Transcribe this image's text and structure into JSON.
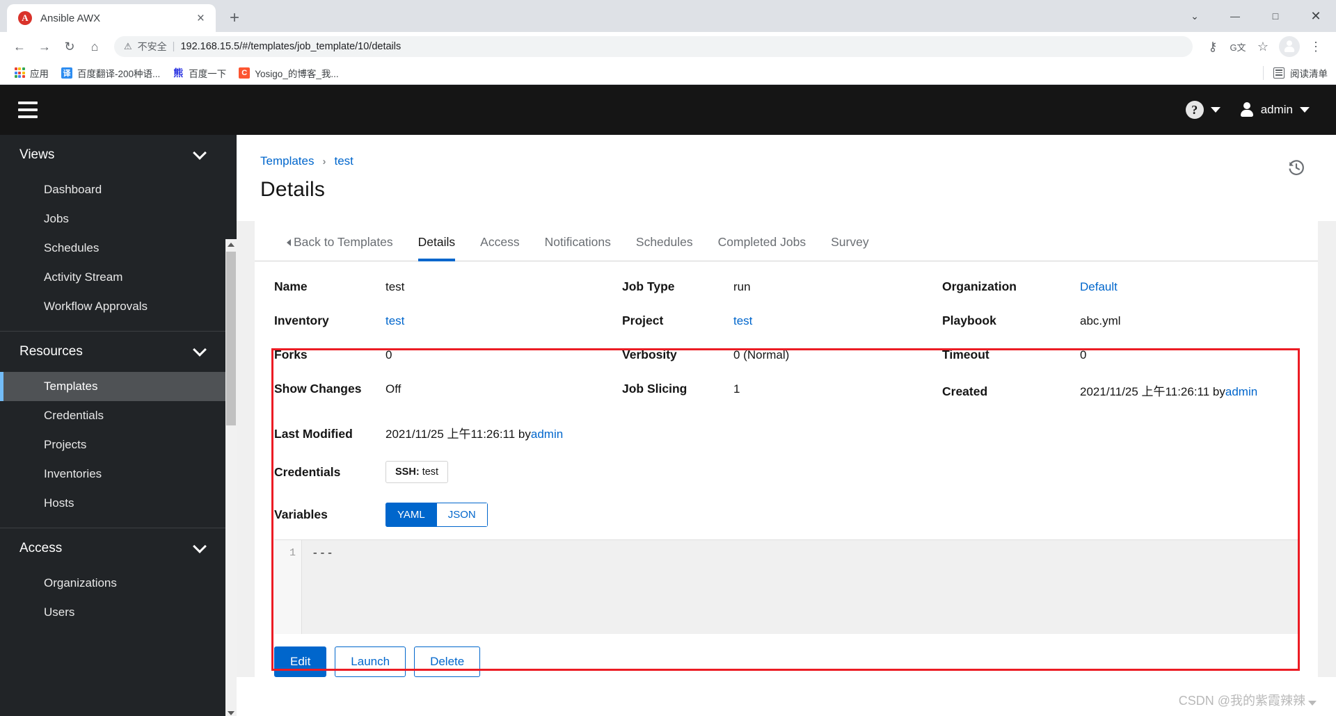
{
  "browser": {
    "tab": {
      "title": "Ansible AWX",
      "favicon_letter": "A",
      "favicon_name": "ansible-logo-icon",
      "close_label": "×"
    },
    "new_tab_label": "+",
    "window_controls": {
      "more": "⌄",
      "minimize": "—",
      "maximize": "□",
      "close": "✕"
    },
    "nav": {
      "back": "←",
      "forward": "→",
      "reload": "↻",
      "home": "⌂"
    },
    "omnibox": {
      "warning_glyph": "⚠",
      "security_text": "不安全",
      "separator": "|",
      "url": "192.168.15.5/#/templates/job_template/10/details"
    },
    "toolbar_right": {
      "password": "⚷",
      "translate": "G文",
      "bookmark_star": "☆",
      "menu": "⋮"
    },
    "bookmarks": [
      {
        "label": "应用",
        "icon": "apps-grid-icon",
        "color": "#4285f4"
      },
      {
        "label": "百度翻译-200种语...",
        "icon": "baidu-translate-icon",
        "glyph": "译",
        "color": "#2d8cf0"
      },
      {
        "label": "百度一下",
        "icon": "baidu-icon",
        "glyph": "熊",
        "color": "#2932e1"
      },
      {
        "label": "Yosigo_的博客_我...",
        "icon": "csdn-icon",
        "glyph": "C",
        "color": "#fc5531"
      }
    ],
    "reading_list": {
      "label": "阅读清单",
      "icon": "reading-list-icon"
    }
  },
  "app_header": {
    "menu_icon": "hamburger-menu-icon",
    "help": {
      "icon": "question-circle-icon",
      "glyph": "?"
    },
    "user": {
      "name": "admin",
      "icon": "user-avatar-icon"
    }
  },
  "sidebar": {
    "sections": [
      {
        "title": "Views",
        "items": [
          "Dashboard",
          "Jobs",
          "Schedules",
          "Activity Stream",
          "Workflow Approvals"
        ]
      },
      {
        "title": "Resources",
        "items": [
          "Templates",
          "Credentials",
          "Projects",
          "Inventories",
          "Hosts"
        ],
        "active": "Templates"
      },
      {
        "title": "Access",
        "items": [
          "Organizations",
          "Users"
        ]
      }
    ]
  },
  "main": {
    "breadcrumb": {
      "root": "Templates",
      "separator": "›",
      "current": "test"
    },
    "page_title": "Details",
    "history_icon": "history-clock-icon",
    "tabs": [
      {
        "label": "Back to Templates",
        "kind": "back"
      },
      {
        "label": "Details",
        "selected": true
      },
      {
        "label": "Access"
      },
      {
        "label": "Notifications"
      },
      {
        "label": "Schedules"
      },
      {
        "label": "Completed Jobs"
      },
      {
        "label": "Survey"
      }
    ],
    "details": {
      "col1": [
        {
          "label": "Name",
          "value": "test",
          "link": false
        },
        {
          "label": "Inventory",
          "value": "test",
          "link": true
        },
        {
          "label": "Forks",
          "value": "0",
          "link": false
        },
        {
          "label": "Show Changes",
          "value": "Off",
          "link": false
        }
      ],
      "col2": [
        {
          "label": "Job Type",
          "value": "run",
          "link": false
        },
        {
          "label": "Project",
          "value": "test",
          "link": true
        },
        {
          "label": "Verbosity",
          "value": "0 (Normal)",
          "link": false
        },
        {
          "label": "Job Slicing",
          "value": "1",
          "link": false
        }
      ],
      "col3": [
        {
          "label": "Organization",
          "value": "Default",
          "link": true
        },
        {
          "label": "Playbook",
          "value": "abc.yml",
          "link": false
        },
        {
          "label": "Timeout",
          "value": "0",
          "link": false
        },
        {
          "label": "Created",
          "value": "2021/11/25 上午11:26:11 by ",
          "link_suffix": "admin"
        }
      ],
      "last_modified": {
        "label": "Last Modified",
        "value": "2021/11/25 上午11:26:11 by ",
        "link_suffix": "admin"
      },
      "credentials": {
        "label": "Credentials",
        "chip_kind": "SSH:",
        "chip_value": "test"
      },
      "variables": {
        "label": "Variables",
        "options": [
          "YAML",
          "JSON"
        ],
        "selected": "YAML"
      }
    },
    "editor": {
      "line_number": "1",
      "content": "---"
    },
    "actions": [
      {
        "label": "Edit",
        "style": "primary"
      },
      {
        "label": "Launch",
        "style": "secondary"
      },
      {
        "label": "Delete",
        "style": "secondary"
      }
    ],
    "highlight_color": "#ec1c24"
  },
  "watermark": {
    "text": "CSDN @我的紫霞辣辣"
  }
}
